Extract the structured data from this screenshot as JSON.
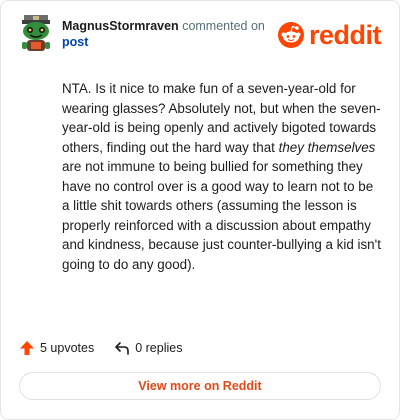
{
  "comment": {
    "author": "MagnusStormraven",
    "action_text": "commented on",
    "post_link": "post",
    "body": {
      "part1": "NTA. Is it nice to make fun of a seven-year-old for wearing glasses? Absolutely not, but when the seven-year-old is being openly and actively bigoted towards others, finding out the hard way that ",
      "emphasis": "they themselves",
      "part2": " are not immune to being bullied for something they have no control over is a good way to learn not to be a little shit towards others (assuming the lesson is properly reinforced with a discussion about empathy and kindness, because just counter-bullying a kid isn't going to do any good)."
    }
  },
  "brand": {
    "wordmark": "reddit",
    "color": "#ff4500"
  },
  "actions": {
    "upvotes": "5 upvotes",
    "replies": "0 replies",
    "upvote_icon": "upvote-arrow-icon",
    "reply_icon": "reply-arrow-icon"
  },
  "footer": {
    "view_more": "View more on Reddit"
  },
  "colors": {
    "accent": "#ff4500",
    "link": "#0045ac",
    "button_text": "#e04a1a"
  }
}
